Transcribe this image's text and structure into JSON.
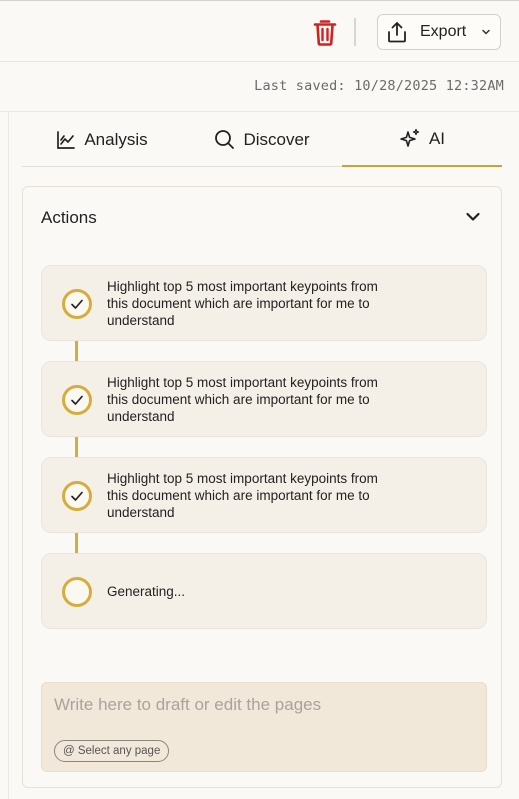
{
  "toolbar": {
    "delete_icon": "trash-icon",
    "export_label": "Export",
    "export_icon": "share-upload-icon",
    "colors": {
      "delete": "#d42020",
      "accent": "#c9a338"
    }
  },
  "status": {
    "last_saved": "Last saved: 10/28/2025 12:32AM"
  },
  "tabs": [
    {
      "label": "Analysis",
      "icon": "chart-line-icon",
      "active": false
    },
    {
      "label": "Discover",
      "icon": "search-icon",
      "active": false
    },
    {
      "label": "AI",
      "icon": "sparkles-icon",
      "active": true
    }
  ],
  "actions": {
    "title": "Actions",
    "steps": [
      {
        "text": "Highlight top 5 most important keypoints from this document which are important for me to understand",
        "status": "done"
      },
      {
        "text": "Highlight top 5 most important keypoints from this document which are important for me to understand",
        "status": "done"
      },
      {
        "text": "Highlight top 5 most important keypoints from this document which are important for me to understand",
        "status": "done"
      },
      {
        "text": "Generating...",
        "status": "pending"
      }
    ]
  },
  "draft": {
    "placeholder": "Write here to draft or edit the pages",
    "value": "",
    "select_page_label": "@ Select any page"
  }
}
